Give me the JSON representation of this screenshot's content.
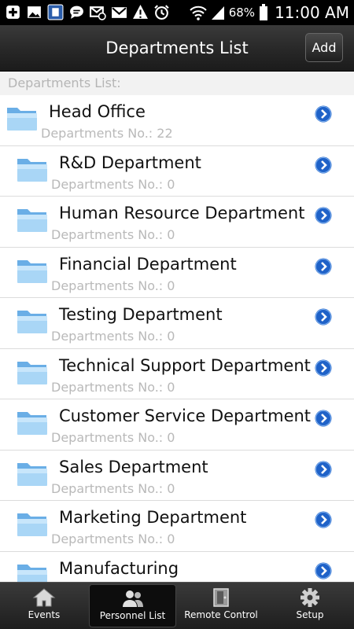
{
  "status_bar": {
    "battery_percent": "68%",
    "time": "11:00 AM",
    "icons": [
      "add-icon",
      "image-icon",
      "app-icon",
      "message-icon",
      "muted-email-icon",
      "gmail-icon",
      "warning-icon",
      "alarm-icon",
      "wifi-icon",
      "signal-icon",
      "battery-icon"
    ]
  },
  "header": {
    "title": "Departments List",
    "add_label": "Add"
  },
  "list": {
    "section_label": "Departments List:",
    "count_label": "Departments No.:",
    "items": [
      {
        "name": "Head Office",
        "count": "22",
        "level": 0
      },
      {
        "name": "R&D Department",
        "count": "0",
        "level": 1
      },
      {
        "name": "Human Resource Department",
        "count": "0",
        "level": 1
      },
      {
        "name": "Financial Department",
        "count": "0",
        "level": 1
      },
      {
        "name": "Testing Department",
        "count": "0",
        "level": 1
      },
      {
        "name": "Technical Support Department",
        "count": "0",
        "level": 1
      },
      {
        "name": "Customer Service Department",
        "count": "0",
        "level": 1
      },
      {
        "name": "Sales Department",
        "count": "0",
        "level": 1
      },
      {
        "name": "Marketing Department",
        "count": "0",
        "level": 1
      },
      {
        "name": "Manufacturing",
        "count": "",
        "level": 1
      }
    ]
  },
  "tabs": [
    {
      "label": "Events",
      "icon": "home-icon",
      "active": false
    },
    {
      "label": "Personnel List",
      "icon": "people-icon",
      "active": true
    },
    {
      "label": "Remote Control",
      "icon": "door-icon",
      "active": false
    },
    {
      "label": "Setup",
      "icon": "gear-icon",
      "active": false
    }
  ],
  "colors": {
    "accent_blue": "#1f62c8",
    "folder_blue": "#8cc4ef",
    "secondary_text": "#b9b9b9"
  }
}
